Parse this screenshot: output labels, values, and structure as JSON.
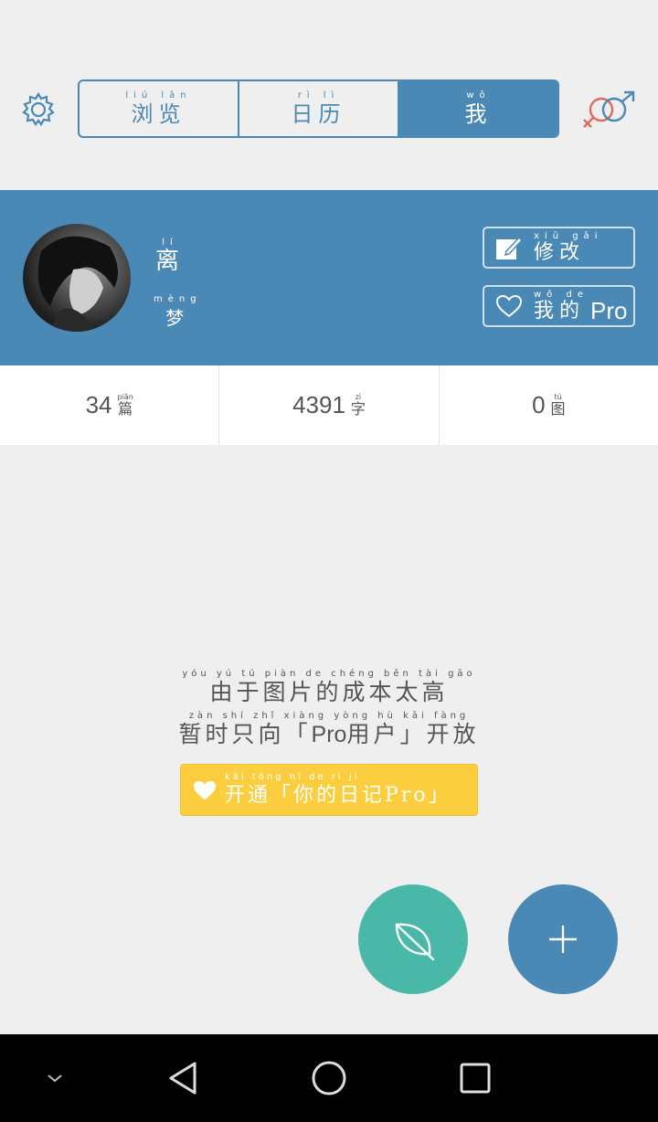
{
  "header": {
    "tabs": [
      {
        "pinyin": "liú lǎn",
        "label": "浏览"
      },
      {
        "pinyin": "rì lì",
        "label": "日历"
      },
      {
        "pinyin": "wǒ",
        "label": "我"
      }
    ]
  },
  "profile": {
    "name_pinyin": "lí",
    "name": "离",
    "name2_pinyin": "mèng",
    "name2": "梦",
    "edit_button": {
      "pinyin": "xiū gǎi",
      "label": "修改"
    },
    "pro_button": {
      "pinyin": "wǒ de",
      "label": "我的",
      "suffix": "Pro"
    }
  },
  "stats": [
    {
      "value": "34",
      "pinyin": "piān",
      "unit": "篇"
    },
    {
      "value": "4391",
      "pinyin": "zì",
      "unit": "字"
    },
    {
      "value": "0",
      "pinyin": "tú",
      "unit": "图"
    }
  ],
  "message": {
    "line1_pinyin": "yóu yú tú piàn de chéng běn tài gāo",
    "line1": "由于图片的成本太高",
    "line2_pinyin": "zàn shí zhǐ xiàng yòng hù kāi fàng",
    "line2_pre": "暂时只向「",
    "line2_pro": "Pro",
    "line2_post": "用户」开放"
  },
  "pro_cta": {
    "pinyin": "kāi tōng nǐ de rì jì",
    "label": "开通「你的日记Pro」"
  },
  "colors": {
    "primary": "#4a88b5",
    "accent": "#fbce3f",
    "leaf": "#49b8a8"
  }
}
